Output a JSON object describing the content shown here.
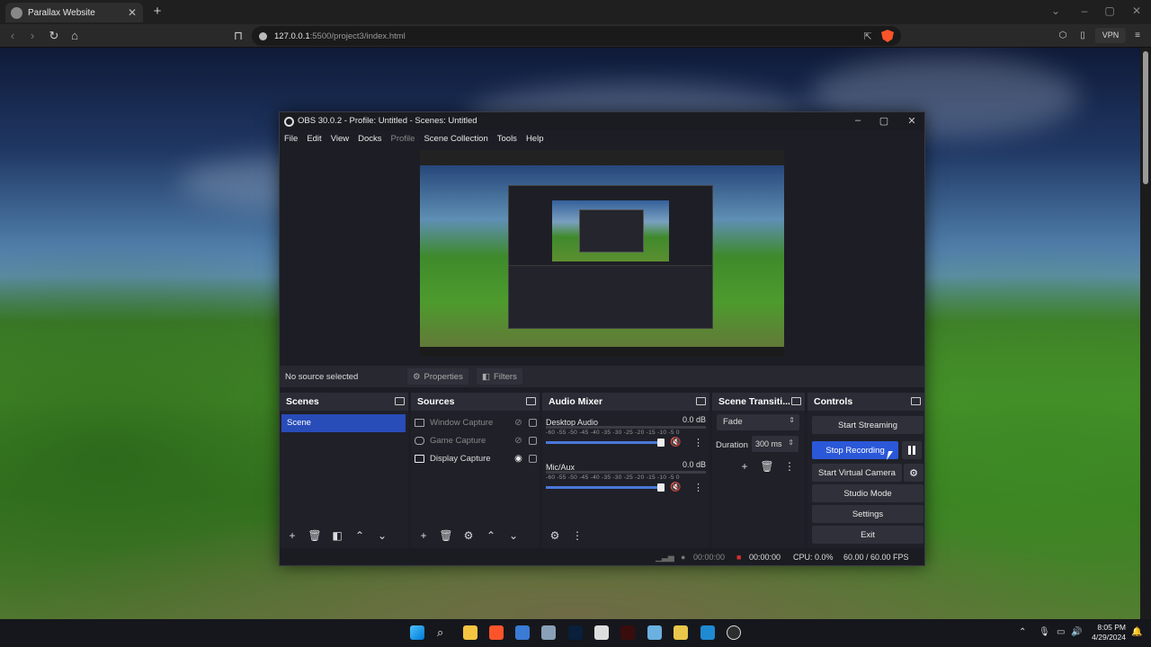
{
  "browser": {
    "tab_title": "Parallax Website",
    "url_host": "127.0.0.1",
    "url_path": ":5500/project3/index.html",
    "vpn_label": "VPN"
  },
  "obs": {
    "title": "OBS 30.0.2 - Profile: Untitled - Scenes: Untitled",
    "menu": [
      "File",
      "Edit",
      "View",
      "Docks",
      "Profile",
      "Scene Collection",
      "Tools",
      "Help"
    ],
    "no_source": "No source selected",
    "properties_label": "Properties",
    "filters_label": "Filters",
    "scenes": {
      "title": "Scenes",
      "items": [
        "Scene"
      ]
    },
    "sources": {
      "title": "Sources",
      "items": [
        {
          "name": "Window Capture",
          "visible": false
        },
        {
          "name": "Game Capture",
          "visible": false
        },
        {
          "name": "Display Capture",
          "visible": true
        }
      ]
    },
    "mixer": {
      "title": "Audio Mixer",
      "channels": [
        {
          "name": "Desktop Audio",
          "db": "0.0 dB",
          "volume": 1.0,
          "muted": true
        },
        {
          "name": "Mic/Aux",
          "db": "0.0 dB",
          "volume": 1.0,
          "muted": true
        }
      ],
      "scale": "-60 -55 -50 -45 -40 -35 -30 -25 -20 -15 -10 -5 0"
    },
    "transitions": {
      "title": "Scene Transiti...",
      "selected": "Fade",
      "duration_label": "Duration",
      "duration_value": "300 ms"
    },
    "controls": {
      "title": "Controls",
      "start_streaming": "Start Streaming",
      "stop_recording": "Stop Recording",
      "start_virtual_camera": "Start Virtual Camera",
      "studio_mode": "Studio Mode",
      "settings": "Settings",
      "exit": "Exit"
    },
    "status": {
      "stream_time": "00:00:00",
      "rec_time": "00:00:00",
      "cpu": "CPU: 0.0%",
      "fps": "60.00 / 60.00 FPS"
    }
  },
  "taskbar": {
    "time": "8:05 PM",
    "date": "4/29/2024"
  },
  "colors": {
    "accent": "#2b58d8",
    "scene_selected": "#284cb8",
    "recording": "#d32f2f"
  }
}
